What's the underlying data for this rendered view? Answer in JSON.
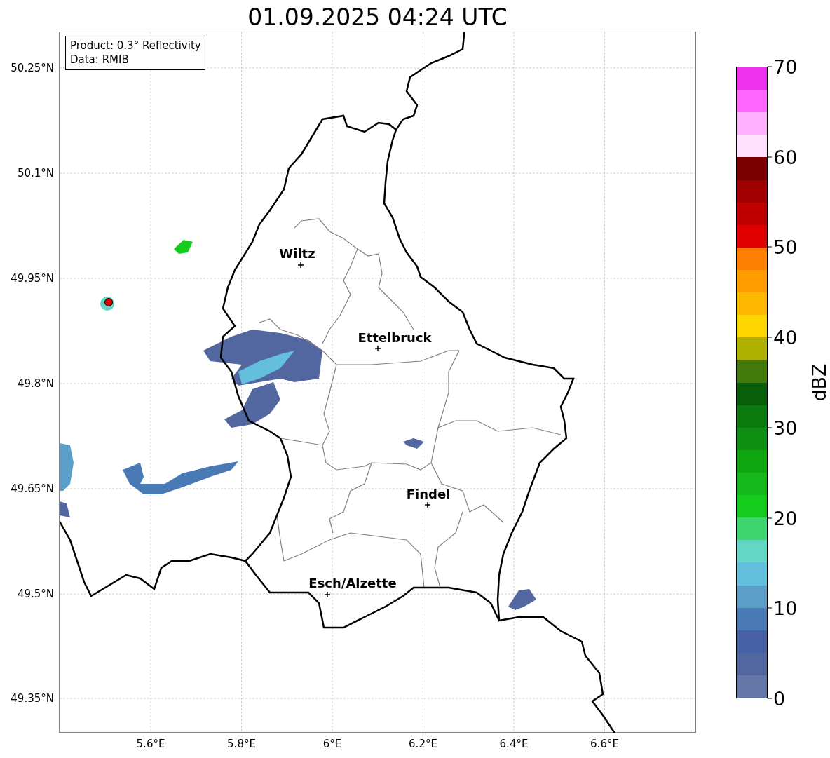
{
  "title": "01.09.2025 04:24 UTC",
  "legend": [
    "Product: 0.3° Reflectivity",
    "Data: RMIB"
  ],
  "lat_ticks": [
    "50.25°N",
    "50.1°N",
    "49.95°N",
    "49.8°N",
    "49.65°N",
    "49.5°N",
    "49.35°N"
  ],
  "lon_ticks": [
    "5.6°E",
    "5.8°E",
    "6°E",
    "6.2°E",
    "6.4°E",
    "6.6°E"
  ],
  "places": [
    {
      "name": "Wiltz"
    },
    {
      "name": "Ettelbruck"
    },
    {
      "name": "Findel"
    },
    {
      "name": "Esch/Alzette"
    }
  ],
  "colorbar": {
    "label": "dBZ",
    "ticks": [
      "70",
      "60",
      "50",
      "40",
      "30",
      "20",
      "10",
      "0"
    ],
    "segments": [
      {
        "color": "#6477a8"
      },
      {
        "color": "#5266a0"
      },
      {
        "color": "#4560a5"
      },
      {
        "color": "#4a7ab5"
      },
      {
        "color": "#5b9fc8"
      },
      {
        "color": "#63bfdc"
      },
      {
        "color": "#63d6c6"
      },
      {
        "color": "#3dd66e"
      },
      {
        "color": "#15cc1c"
      },
      {
        "color": "#14b81a"
      },
      {
        "color": "#10a612"
      },
      {
        "color": "#0f8f11"
      },
      {
        "color": "#0c7a0e"
      },
      {
        "color": "#095e0a"
      },
      {
        "color": "#447a0c"
      },
      {
        "color": "#b0b000"
      },
      {
        "color": "#ffd700"
      },
      {
        "color": "#ffb800"
      },
      {
        "color": "#ff9c00"
      },
      {
        "color": "#ff7f00"
      },
      {
        "color": "#e00000"
      },
      {
        "color": "#c00000"
      },
      {
        "color": "#a00000"
      },
      {
        "color": "#7a0000"
      },
      {
        "color": "#ffe0ff"
      },
      {
        "color": "#ffb0ff"
      },
      {
        "color": "#ff66ff"
      },
      {
        "color": "#ee33ee"
      }
    ]
  }
}
